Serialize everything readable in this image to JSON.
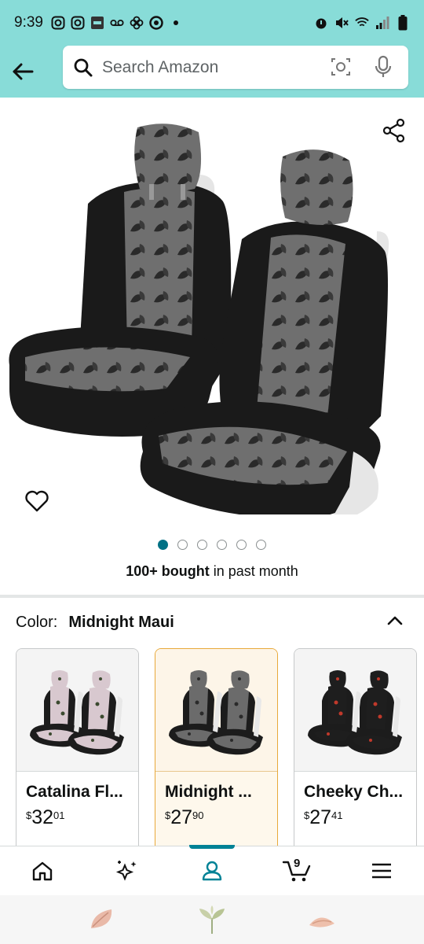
{
  "status_bar": {
    "time": "9:39",
    "left_icons": [
      "instagram-icon",
      "instagram-icon",
      "ring-icon",
      "voicemail-icon",
      "pinwheel-icon",
      "target-icon",
      "dot-icon"
    ],
    "right_icons": [
      "alarm-icon",
      "mute-icon",
      "wifi-icon",
      "signal-icon",
      "battery-icon"
    ]
  },
  "header": {
    "search_placeholder": "Search Amazon",
    "background": "#88dcd8"
  },
  "product": {
    "image_count": 6,
    "active_image": 0,
    "bought_strong": "100+ bought",
    "bought_rest": " in past month"
  },
  "color": {
    "label": "Color:",
    "value": "Midnight Maui"
  },
  "swatches": [
    {
      "name": "Catalina Fl...",
      "currency": "$",
      "whole": "32",
      "fraction": "01",
      "pattern": "floral",
      "selected": false
    },
    {
      "name": "Midnight ...",
      "currency": "$",
      "whole": "27",
      "fraction": "90",
      "pattern": "midnight",
      "selected": true
    },
    {
      "name": "Cheeky Ch...",
      "currency": "$",
      "whole": "27",
      "fraction": "41",
      "pattern": "cherry",
      "selected": false
    }
  ],
  "bottom_nav": {
    "items": [
      "home-icon",
      "ai-sparkle-icon",
      "account-icon",
      "cart-icon",
      "menu-icon"
    ],
    "active_index": 2,
    "cart_count": "9"
  },
  "colors": {
    "accent": "#008296",
    "selected_border": "#e8a93a",
    "link": "#007185"
  }
}
